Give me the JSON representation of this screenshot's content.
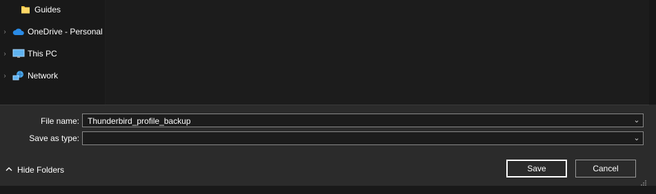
{
  "nav": {
    "items": [
      {
        "label": "Guides",
        "icon": "folder-icon",
        "has_chevron": false
      },
      {
        "label": "OneDrive - Personal",
        "icon": "onedrive-cloud-icon",
        "has_chevron": true
      },
      {
        "label": "This PC",
        "icon": "computer-icon",
        "has_chevron": true
      },
      {
        "label": "Network",
        "icon": "network-icon",
        "has_chevron": true
      }
    ]
  },
  "form": {
    "file_name_label": "File name:",
    "file_name_value": "Thunderbird_profile_backup",
    "save_as_type_label": "Save as type:",
    "save_as_type_value": ""
  },
  "footer": {
    "hide_folders_label": "Hide Folders",
    "save_label": "Save",
    "cancel_label": "Cancel"
  },
  "colors": {
    "background": "#191919",
    "bottom_panel": "#2b2b2b",
    "field_border": "#8a8a8a",
    "folder_yellow": "#f5c542",
    "onedrive_blue": "#2a8be6"
  }
}
